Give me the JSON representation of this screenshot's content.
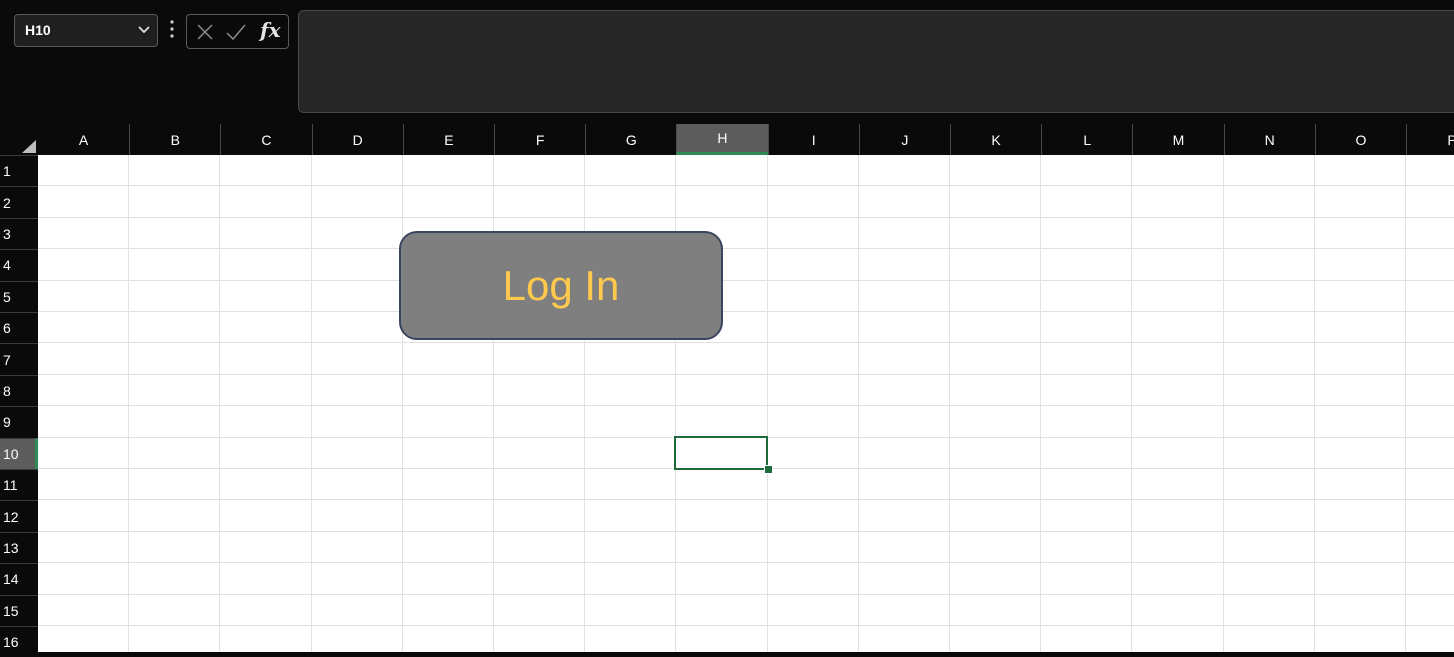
{
  "name_box": {
    "value": "H10"
  },
  "formula_bar": {
    "function_label": "fx",
    "value": ""
  },
  "columns": [
    "A",
    "B",
    "C",
    "D",
    "E",
    "F",
    "G",
    "H",
    "I",
    "J",
    "K",
    "L",
    "M",
    "N",
    "O",
    "P"
  ],
  "rows": [
    "1",
    "2",
    "3",
    "4",
    "5",
    "6",
    "7",
    "8",
    "9",
    "10",
    "11",
    "12",
    "13",
    "14",
    "15",
    "16"
  ],
  "selected_column": "H",
  "selected_row": "10",
  "shape_button": {
    "label": "Log In"
  },
  "colors": {
    "selection": "#1e6b3b",
    "button_fill": "#7f7f7f",
    "button_text": "#ffc94d",
    "header_bg": "#0a0a0a"
  },
  "icons": {
    "name_box_dropdown": "chevron-down-icon",
    "more": "vertical-dots-icon",
    "cancel": "close-icon",
    "enter": "checkmark-icon",
    "insert_function": "fx-icon",
    "select_all": "select-all-triangle-icon"
  }
}
